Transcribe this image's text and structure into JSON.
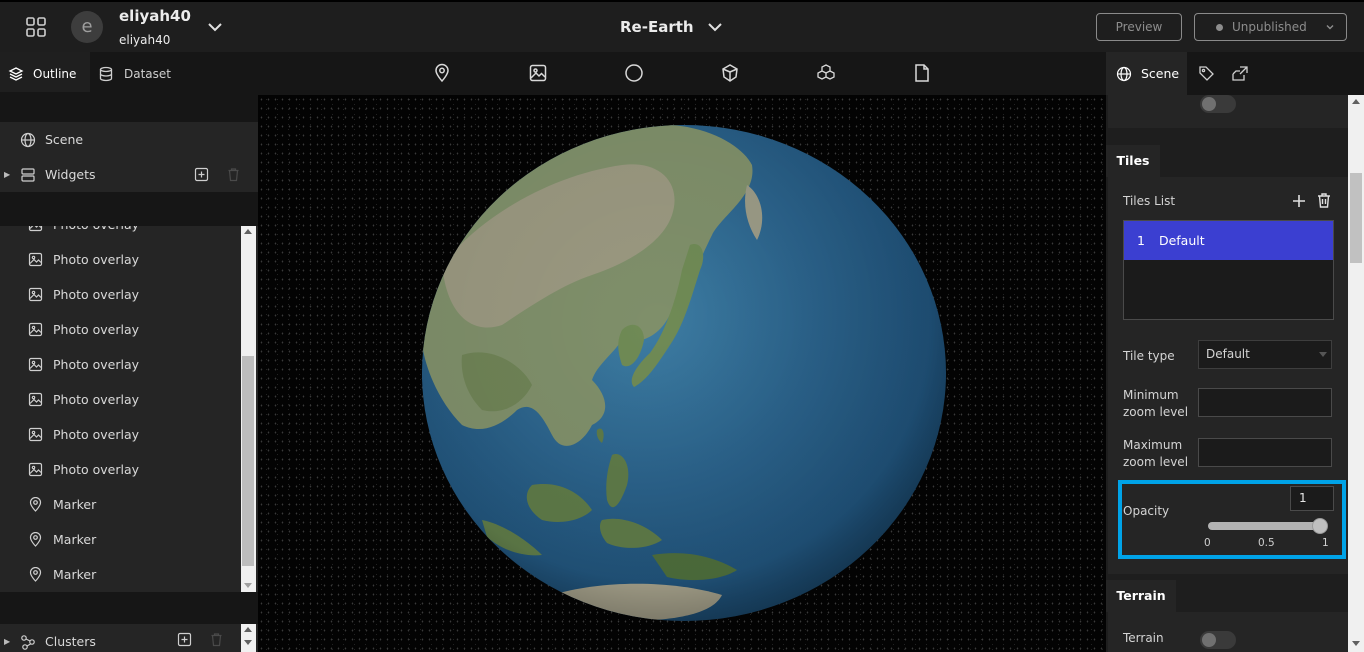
{
  "header": {
    "avatar_letter": "e",
    "workspace_name": "eliyah40",
    "workspace_sub": "eliyah40",
    "project_name": "Re-Earth",
    "preview_label": "Preview",
    "publish_status": "Unpublished"
  },
  "left_panel": {
    "tabs": [
      {
        "label": "Outline",
        "icon": "layers-icon",
        "active": true
      },
      {
        "label": "Dataset",
        "icon": "database-icon",
        "active": false
      }
    ],
    "scene_label": "Scene",
    "widgets_label": "Widgets",
    "layers": [
      {
        "label": "Photo overlay",
        "icon": "image-icon"
      },
      {
        "label": "Photo overlay",
        "icon": "image-icon"
      },
      {
        "label": "Photo overlay",
        "icon": "image-icon"
      },
      {
        "label": "Photo overlay",
        "icon": "image-icon"
      },
      {
        "label": "Photo overlay",
        "icon": "image-icon"
      },
      {
        "label": "Photo overlay",
        "icon": "image-icon"
      },
      {
        "label": "Photo overlay",
        "icon": "image-icon"
      },
      {
        "label": "Photo overlay",
        "icon": "image-icon"
      },
      {
        "label": "Marker",
        "icon": "marker-icon"
      },
      {
        "label": "Marker",
        "icon": "marker-icon"
      },
      {
        "label": "Marker",
        "icon": "marker-icon"
      }
    ],
    "clusters_label": "Clusters"
  },
  "toolbar": {
    "tools": [
      "marker-tool-icon",
      "image-tool-icon",
      "circle-tool-icon",
      "box-tool-icon",
      "model-tool-icon",
      "file-tool-icon"
    ]
  },
  "right_panel": {
    "tabs": [
      {
        "label": "Scene",
        "icon": "globe-icon",
        "active": true
      },
      {
        "label": "",
        "icon": "tag-icon",
        "active": false
      },
      {
        "label": "",
        "icon": "export-icon",
        "active": false
      }
    ],
    "tiles": {
      "section_title": "Tiles",
      "list_title": "Tiles List",
      "items": [
        {
          "index": "1",
          "label": "Default",
          "selected": true
        }
      ],
      "tile_type_label": "Tile type",
      "tile_type_value": "Default",
      "min_zoom_label_1": "Minimum",
      "min_zoom_label_2": "zoom level",
      "min_zoom_value": "",
      "max_zoom_label_1": "Maximum",
      "max_zoom_label_2": "zoom level",
      "max_zoom_value": "",
      "opacity_label": "Opacity",
      "opacity_value": "1",
      "opacity_min": 0,
      "opacity_max": 1,
      "opacity_marks": [
        "0",
        "0.5",
        "1"
      ]
    },
    "terrain": {
      "section_title": "Terrain",
      "terrain_label": "Terrain",
      "enabled": false
    }
  },
  "colors": {
    "selection_blue": "#3b3fd1",
    "highlight_border": "#00a3e8"
  }
}
